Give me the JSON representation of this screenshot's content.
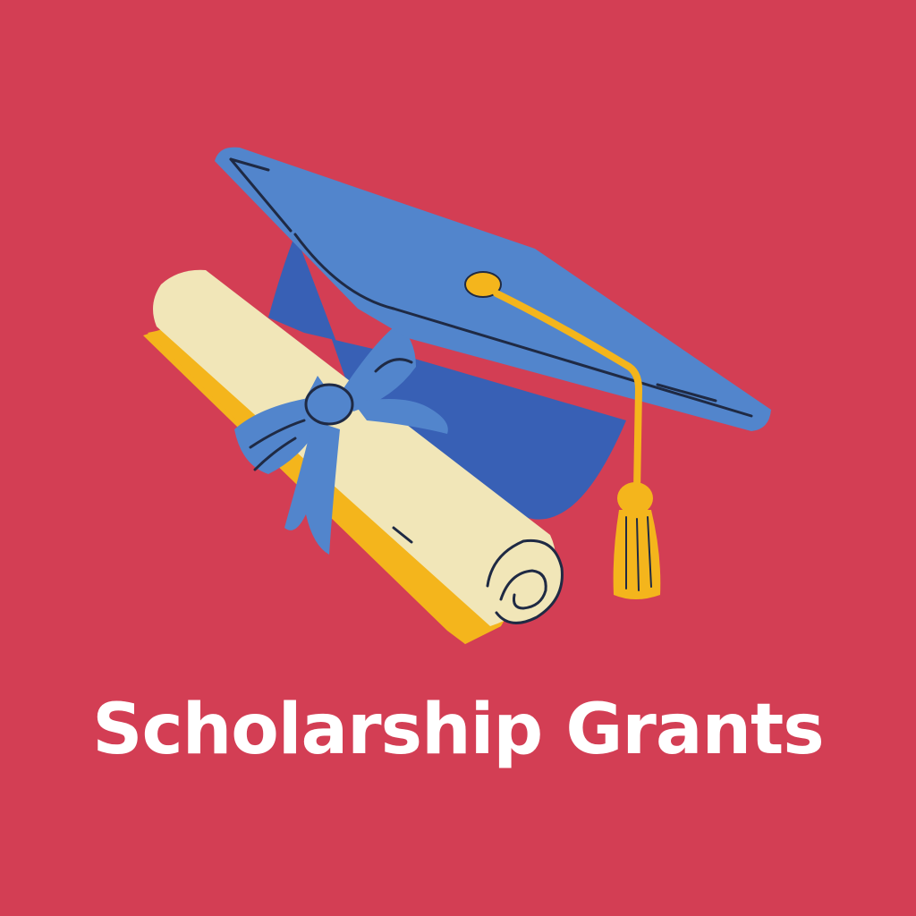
{
  "title": "Scholarship Grants",
  "colors": {
    "background": "#d33e54",
    "cap_top": "#5285cc",
    "cap_base": "#3860b5",
    "tassel": "#f4b51c",
    "scroll_paper": "#f1e6b8",
    "scroll_backing": "#f4b51c",
    "ribbon": "#5285cc",
    "text": "#ffffff"
  },
  "icons": [
    "graduation-cap-icon",
    "diploma-scroll-icon",
    "ribbon-bow-icon",
    "tassel-icon"
  ]
}
